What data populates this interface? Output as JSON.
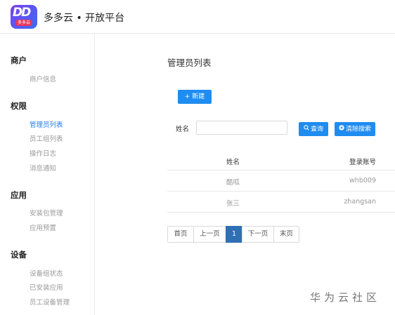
{
  "header": {
    "logo_text": "DD",
    "logo_badge": "多多云",
    "app_title": "多多云 • 开放平台"
  },
  "sidebar": {
    "sections": [
      {
        "title": "商户",
        "items": [
          {
            "label": "商户信息"
          }
        ]
      },
      {
        "title": "权限",
        "items": [
          {
            "label": "管理员列表",
            "active": true
          },
          {
            "label": "员工组列表"
          },
          {
            "label": "操作日志"
          },
          {
            "label": "消息通知"
          }
        ]
      },
      {
        "title": "应用",
        "items": [
          {
            "label": "安装包管理"
          },
          {
            "label": "应用预置"
          }
        ]
      },
      {
        "title": "设备",
        "items": [
          {
            "label": "设备组状态"
          },
          {
            "label": "已安装应用"
          },
          {
            "label": "员工设备管理"
          }
        ]
      }
    ]
  },
  "main": {
    "title": "管理员列表",
    "new_button": "+ 新建",
    "search": {
      "label": "姓名",
      "value": "",
      "placeholder": ""
    },
    "query_button": "查询",
    "clear_button": "清除搜索",
    "table": {
      "columns": [
        "姓名",
        "登录账号"
      ],
      "rows": [
        [
          "酷呱",
          "whb009"
        ],
        [
          "张三",
          "zhangsan"
        ]
      ]
    },
    "pagination": {
      "first": "首页",
      "prev": "上一页",
      "current": "1",
      "next": "下一页",
      "last": "末页"
    }
  },
  "watermark": "华为云社区",
  "colors": {
    "primary": "#1f8cf0",
    "active_link": "#1f7ef0",
    "pager_active": "#2f6fb3",
    "logo_gradient_start": "#7b3ff2",
    "logo_gradient_end": "#3a6df0",
    "logo_badge": "#e8355c"
  }
}
